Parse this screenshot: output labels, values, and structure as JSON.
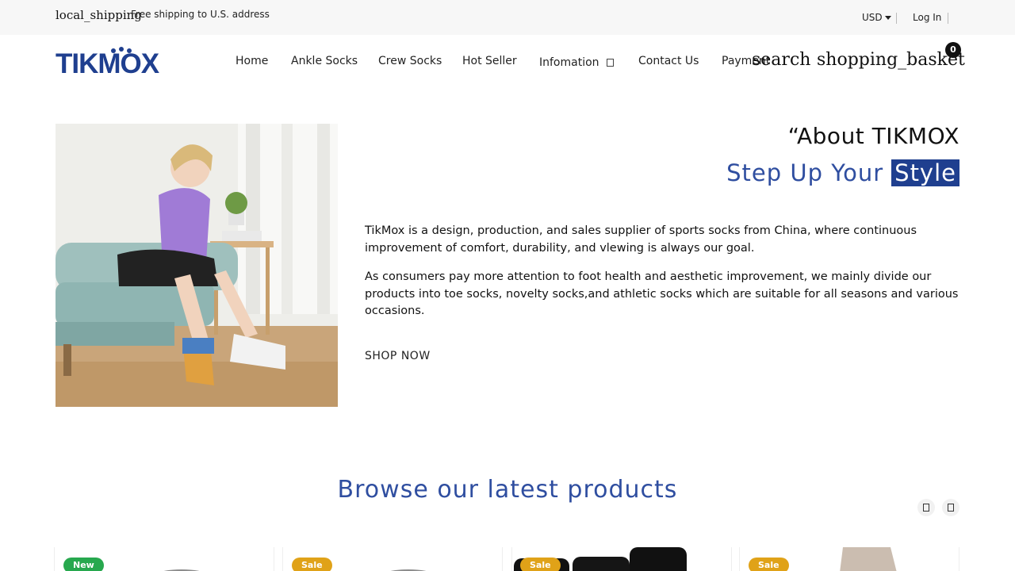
{
  "topbar": {
    "shipping_icon": "local_shipping",
    "shipping_text": "Free shipping to U.S. address",
    "currency": "USD",
    "login": "Log In"
  },
  "header": {
    "logo_text": "TIKMOX",
    "nav": [
      {
        "label": "Home"
      },
      {
        "label": "Ankle Socks"
      },
      {
        "label": "Crew Socks"
      },
      {
        "label": "Hot Seller"
      },
      {
        "label": "Infomation"
      },
      {
        "label": "Contact Us"
      },
      {
        "label": "Payment"
      }
    ],
    "search_icon": "search",
    "basket_icon": "shopping_basket",
    "cart_count": "0"
  },
  "about": {
    "heading": "“About TIKMOX",
    "subheading": "Step Up Your",
    "subheading_highlight": "Style",
    "paragraph1": "TikMox is a design, production, and sales supplier of sports socks from China, where continuous improvement of comfort, durability, and vlewing is always our goal.",
    "paragraph2": "As consumers pay more attention to foot health and aesthetic improvement, we mainly divide our products into toe socks, novelty socks,and athletic socks which are suitable for all seasons and various occasions.",
    "cta": "SHOP NOW"
  },
  "products": {
    "heading": "Browse our latest products",
    "cards": [
      {
        "badge": "New"
      },
      {
        "badge": "Sale"
      },
      {
        "badge": "Sale"
      },
      {
        "badge": "Sale"
      }
    ]
  },
  "colors": {
    "brand_blue": "#1f3f8f",
    "heading_blue": "#2f4ea0",
    "badge_new": "#27a84e",
    "badge_sale": "#e0a218"
  }
}
